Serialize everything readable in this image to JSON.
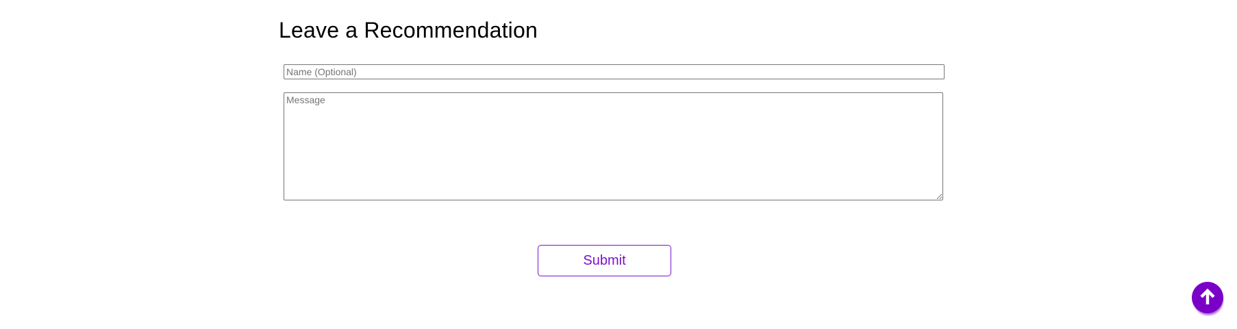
{
  "form": {
    "title": "Leave a Recommendation",
    "name_placeholder": "Name (Optional)",
    "name_value": "",
    "message_placeholder": "Message",
    "message_value": "",
    "submit_label": "Submit"
  },
  "scroll_top": {
    "icon": "arrow-up-icon"
  },
  "colors": {
    "accent": "#7a00c8",
    "text": "#000000",
    "placeholder": "#757575",
    "input_border": "#767676",
    "background": "#ffffff"
  }
}
